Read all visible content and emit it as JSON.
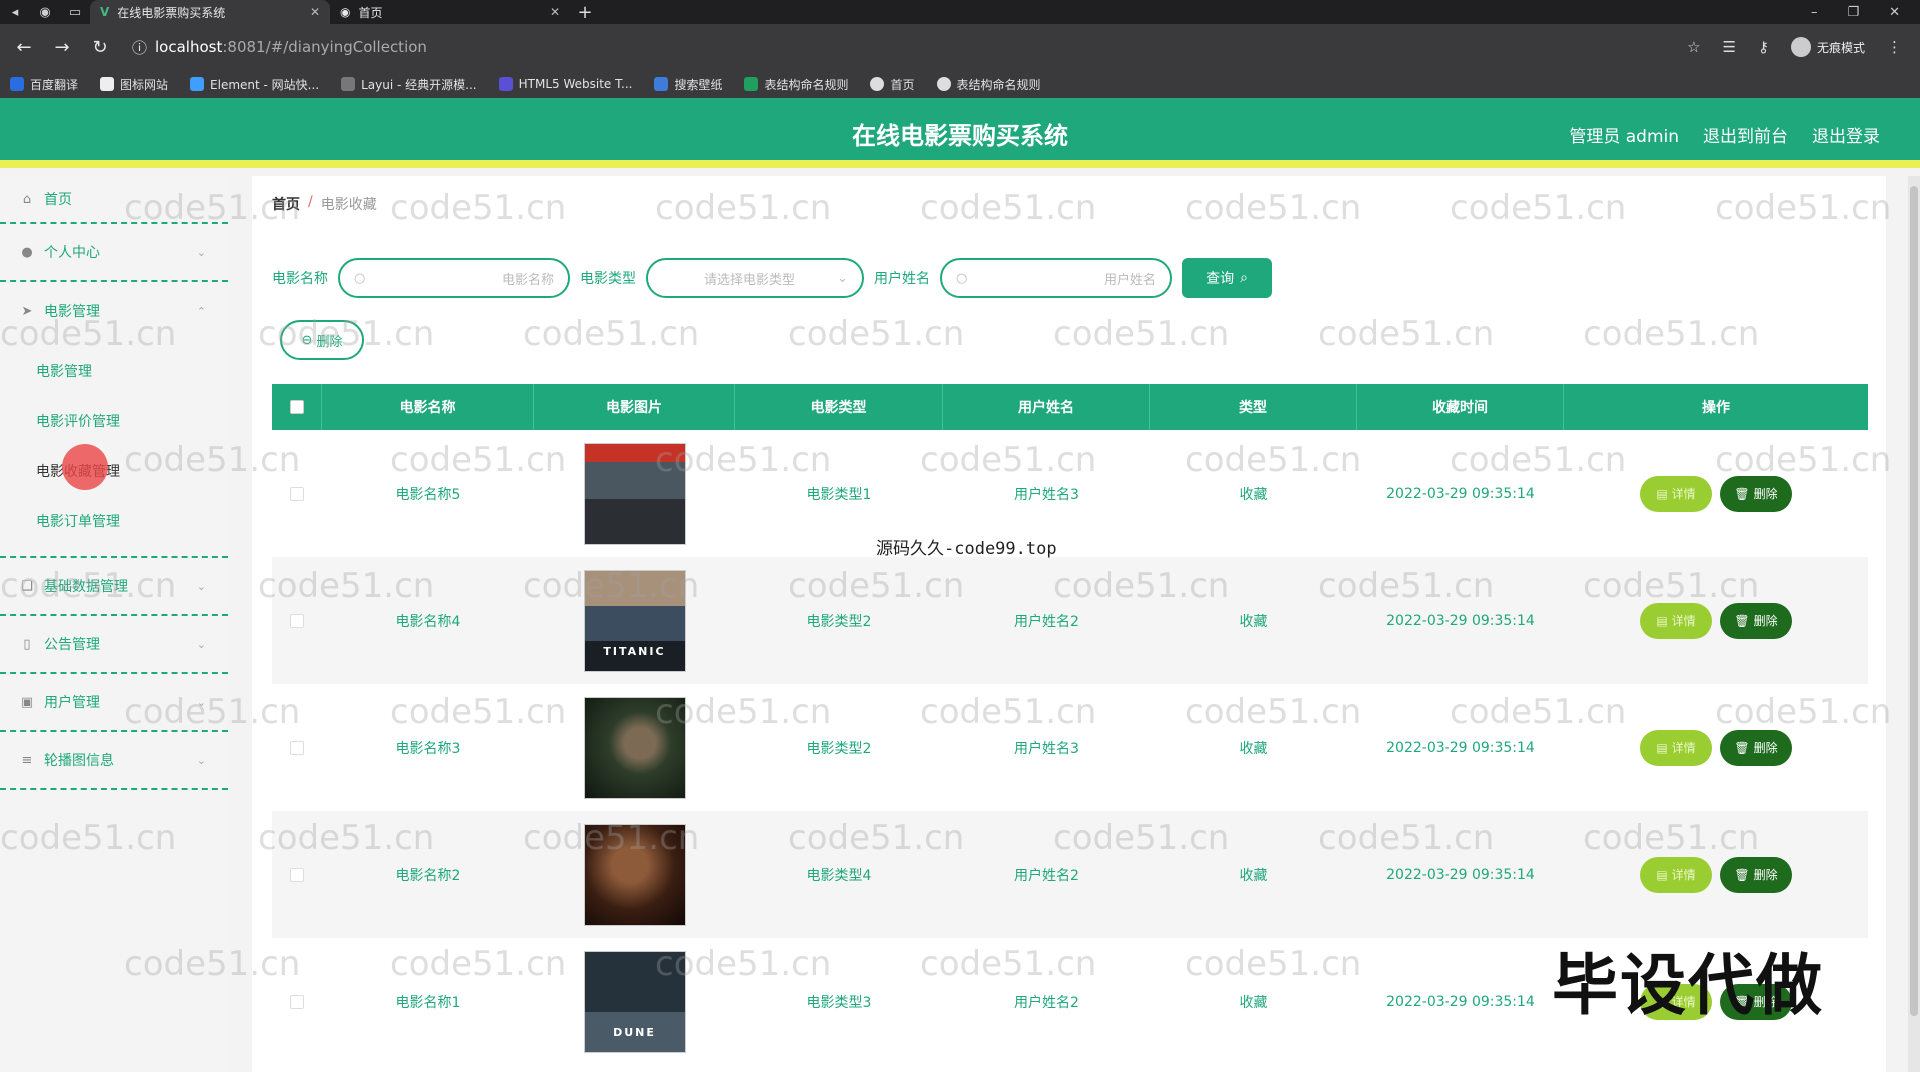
{
  "browser": {
    "tabs": [
      {
        "title": "在线电影票购买系统",
        "active": true
      },
      {
        "title": "首页",
        "active": false
      }
    ],
    "url_host": "localhost",
    "url_path": ":8081/#/dianyingCollection",
    "profile_label": "无痕模式",
    "bookmarks": [
      "百度翻译",
      "图标网站",
      "Element - 网站快...",
      "Layui - 经典开源模...",
      "HTML5 Website T...",
      "搜索壁纸",
      "表结构命名规则",
      "首页",
      "表结构命名规则"
    ]
  },
  "header": {
    "title": "在线电影票购买系统",
    "admin_label": "管理员 admin",
    "back_front_label": "退出到前台",
    "logout_label": "退出登录"
  },
  "sidebar": {
    "home": "首页",
    "personal": "个人中心",
    "movie_mgmt": "电影管理",
    "movie_sub": [
      "电影管理",
      "电影评价管理",
      "电影收藏管理",
      "电影订单管理"
    ],
    "base_data": "基础数据管理",
    "notice": "公告管理",
    "user": "用户管理",
    "carousel": "轮播图信息"
  },
  "breadcrumb": {
    "home": "首页",
    "sep": "/",
    "current": "电影收藏"
  },
  "search": {
    "name_label": "电影名称",
    "name_placeholder": "电影名称",
    "type_label": "电影类型",
    "type_placeholder": "请选择电影类型",
    "user_label": "用户姓名",
    "user_placeholder": "用户姓名",
    "button": "查询"
  },
  "delete_button": "删除",
  "table": {
    "headers": [
      "电影名称",
      "电影图片",
      "电影类型",
      "用户姓名",
      "类型",
      "收藏时间",
      "操作"
    ],
    "rows": [
      {
        "name": "电影名称5",
        "poster_text": "",
        "type": "电影类型1",
        "user": "用户姓名3",
        "kind": "收藏",
        "time": "2022-03-29 09:35:14"
      },
      {
        "name": "电影名称4",
        "poster_text": "TITANIC",
        "type": "电影类型2",
        "user": "用户姓名2",
        "kind": "收藏",
        "time": "2022-03-29 09:35:14"
      },
      {
        "name": "电影名称3",
        "poster_text": "",
        "type": "电影类型2",
        "user": "用户姓名3",
        "kind": "收藏",
        "time": "2022-03-29 09:35:14"
      },
      {
        "name": "电影名称2",
        "poster_text": "",
        "type": "电影类型4",
        "user": "用户姓名2",
        "kind": "收藏",
        "time": "2022-03-29 09:35:14"
      },
      {
        "name": "电影名称1",
        "poster_text": "DUNE",
        "type": "电影类型3",
        "user": "用户姓名2",
        "kind": "收藏",
        "time": "2022-03-29 09:35:14"
      }
    ],
    "detail_label": "详情",
    "delete_label": "删除"
  },
  "overlay": {
    "source_text": "源码久久-code99.top",
    "big_text": "毕设代做",
    "watermark": "code51.cn"
  },
  "colors": {
    "primary": "#1fa87c",
    "accent_yellow": "#e9f052",
    "detail_btn": "#9acd32",
    "delete_btn": "#1e6b1e"
  }
}
